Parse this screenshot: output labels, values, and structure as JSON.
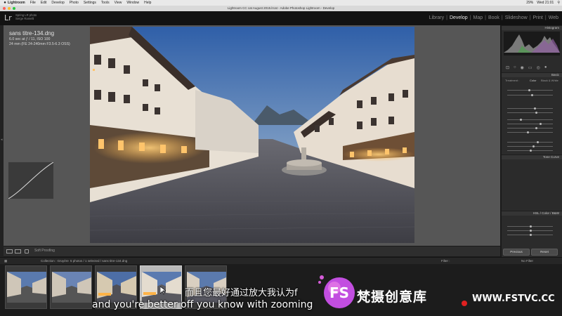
{
  "menubar": {
    "app": "Lightroom",
    "items": [
      "File",
      "Edit",
      "Develop",
      "Photo",
      "Settings",
      "Tools",
      "View",
      "Window",
      "Help"
    ],
    "battery": "29%",
    "clock": "Wed 21:01"
  },
  "window": {
    "title": "Lightroom CC cat August 2015.lrcat - Adobe Photoshop Lightroom - Develop"
  },
  "identity": {
    "logo": "Lr",
    "line1": "Spring LR photo",
    "line2": "Serge Ramelli"
  },
  "modules": [
    "Library",
    "Develop",
    "Map",
    "Book",
    "Slideshow",
    "Print",
    "Web"
  ],
  "photo_info": {
    "filename": "sans titre-134.dng",
    "exposure": "6.0 sec at ƒ / 11, ISO 100",
    "lens": "24 mm (FE 24-240mm F3.5-6.3 OSS)"
  },
  "toolbar": {
    "soft_proofing": "Soft Proofing"
  },
  "right_panel": {
    "histogram": "Histogram",
    "basic": "Basic",
    "treatment": "Treatment :",
    "color": "Color",
    "bw": "Black & White",
    "tone_curve": "Tone Curve",
    "hsl": "HSL / Color / B&W",
    "previous": "Previous",
    "reset": "Reset"
  },
  "filmstrip_bar": {
    "collection": "Collection : Gruyère",
    "count": "5 photos / 1 selected / sans titre-134.dng",
    "filter_label": "Filter :",
    "filter_value": "No Filter"
  },
  "subtitles": {
    "chinese": "而且您最好通过放大我认为f",
    "english": "and you're better off you know with zooming"
  },
  "watermark": {
    "name": "梵摄创意库",
    "url": "WWW.FSTVC.CC"
  },
  "colors": {
    "active_module": "#e6e6e6",
    "panel_bg": "#2b2b2b",
    "center_bg": "#565656",
    "sky": "#5d80b6",
    "lamp": "#ffb347"
  }
}
